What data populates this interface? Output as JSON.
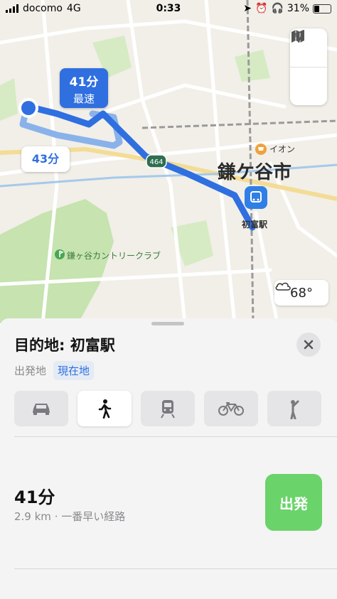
{
  "status_bar": {
    "carrier": "docomo",
    "network": "4G",
    "time": "0:33",
    "battery": "31%"
  },
  "map": {
    "route_primary_time": "41分",
    "route_primary_tag": "最速",
    "route_alt_time": "43分",
    "highway_number": "464",
    "city_label": "鎌ケ谷市",
    "store_label": "イオン",
    "station_label": "初富駅",
    "poi_label": "鎌ヶ谷カントリークラブ",
    "weather_temp": "68°",
    "icons": {
      "map_mode": "map-icon",
      "locate": "location-arrow-icon",
      "weather": "cloud-icon",
      "station": "train-icon",
      "store": "cart-icon",
      "poi": "golf-icon"
    }
  },
  "directions": {
    "title": "目的地: 初富駅",
    "origin_label": "出発地",
    "origin_value": "現在地",
    "modes": [
      {
        "name": "drive",
        "icon": "car-icon"
      },
      {
        "name": "walk",
        "icon": "walk-icon"
      },
      {
        "name": "transit",
        "icon": "train-icon"
      },
      {
        "name": "cycle",
        "icon": "bicycle-icon"
      },
      {
        "name": "rideshare",
        "icon": "hail-icon"
      }
    ],
    "selected_mode": "walk",
    "route_time": "41分",
    "route_detail": "2.9 km · 一番早い経路",
    "go_label": "出発"
  },
  "colors": {
    "route_blue": "#2f6fe0",
    "go_green": "#6ad36a",
    "park_green": "#c6e3b0"
  }
}
